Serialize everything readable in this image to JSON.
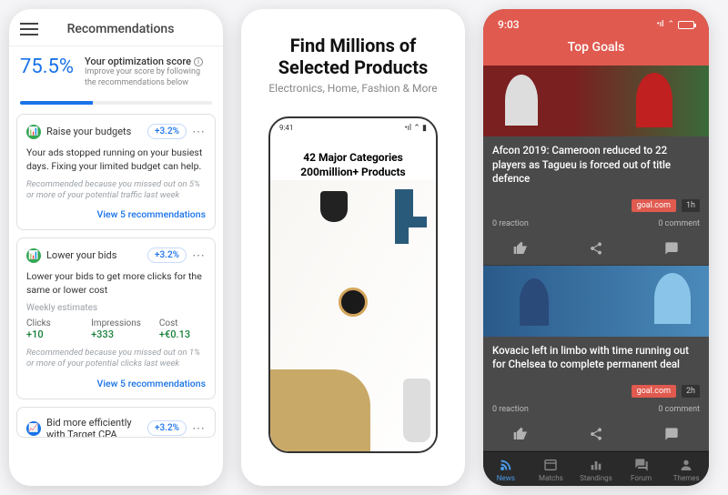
{
  "phone1": {
    "header": "Recommendations",
    "score_pct": "75.5%",
    "score_title": "Your optimization score",
    "score_sub": "Improve your score by following the recommendations below",
    "bar_width": "38%",
    "card1": {
      "title": "Raise your budgets",
      "badge": "+3.2%",
      "desc": "Your ads stopped running on your busiest days. Fixing your limited budget can help.",
      "reason": "Recommended because you missed out on 5% or more of your potential traffic last week",
      "link": "View 5 recommendations"
    },
    "card2": {
      "title": "Lower your bids",
      "badge": "+3.2%",
      "desc": "Lower your bids to get more clicks for the same or lower cost",
      "est_label": "Weekly estimates",
      "clicks_l": "Clicks",
      "clicks_v": "+10",
      "impr_l": "Impressions",
      "impr_v": "+333",
      "cost_l": "Cost",
      "cost_v": "+€0.13",
      "reason": "Recommended because you missed out on 1% or more of your potential clicks last week",
      "link": "View 5 recommendations"
    },
    "card3": {
      "title": "Bid more efficiently with Target CPA",
      "badge": "+3.2%"
    }
  },
  "phone2": {
    "headline": "Find Millions of Selected Products",
    "sub": "Electronics, Home, Fashion & More",
    "time": "9:41",
    "inner1": "42 Major Categories",
    "inner2": "200million+ Products"
  },
  "phone3": {
    "time": "9:03",
    "title": "Top Goals",
    "art1": {
      "headline": "Afcon 2019: Cameroon reduced to 22 players as Tagueu is forced out of title defence",
      "source": "goal.com",
      "ago": "1h",
      "reactions": "0 reaction",
      "comments": "0 comment"
    },
    "art2": {
      "headline": "Kovacic left in limbo with time running out for Chelsea to complete permanent deal",
      "source": "goal.com",
      "ago": "2h",
      "reactions": "0 reaction",
      "comments": "0 comment"
    },
    "tabs": {
      "news": "News",
      "matchs": "Matchs",
      "standings": "Standings",
      "forum": "Forum",
      "themes": "Themes"
    }
  }
}
